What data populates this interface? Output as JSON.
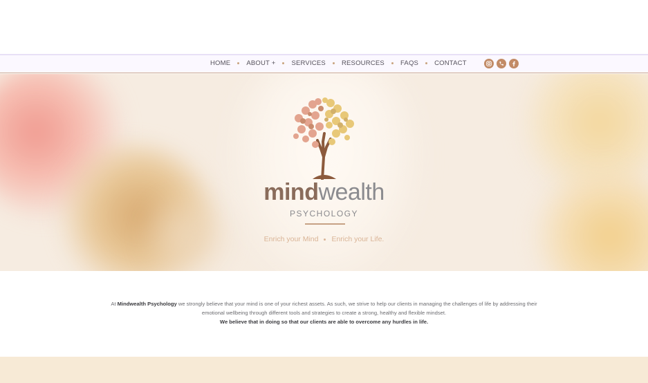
{
  "nav": {
    "items": [
      "HOME",
      "ABOUT +",
      "SERVICES",
      "RESOURCES",
      "FAQS",
      "CONTACT"
    ],
    "social_icons": [
      "instagram-icon",
      "phone-icon",
      "facebook-icon"
    ]
  },
  "hero": {
    "brand_bold": "mind",
    "brand_light": "wealth",
    "subtitle": "PSYCHOLOGY",
    "tagline_left": "Enrich your Mind",
    "tagline_right": "Enrich your Life."
  },
  "intro": {
    "prefix": "At ",
    "brand": "Mindwealth Psychology",
    "body": " we strongly believe that your mind is one of your richest assets. As such, we strive to help our clients in managing the challenges of life by addressing their emotional wellbeing through different tools and strategies to create a strong, healthy and flexible mindset.",
    "emphasis": "We believe that in doing so that our clients are able to overcome any hurdles in life."
  },
  "colors": {
    "accent": "#c28b66",
    "nav_text": "#55515b",
    "footer_band": "#f7ead6"
  }
}
